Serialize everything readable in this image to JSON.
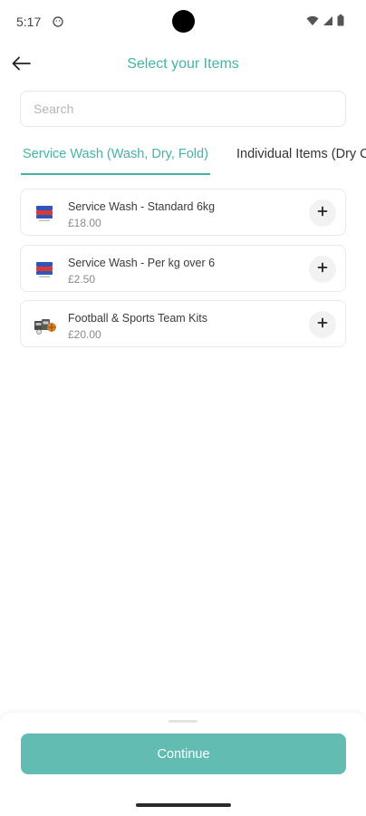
{
  "status_bar": {
    "time": "5:17",
    "notification_icon": "face-icon",
    "wifi_icon": "wifi-icon",
    "signal_icon": "signal-icon",
    "battery_icon": "battery-icon"
  },
  "header": {
    "title": "Select your Items",
    "back_icon": "arrow-left-icon"
  },
  "search": {
    "placeholder": "Search",
    "value": ""
  },
  "tabs": [
    {
      "label": "Service Wash (Wash, Dry, Fold)",
      "active": true
    },
    {
      "label": "Individual Items (Dry Cleaning)",
      "active": false
    }
  ],
  "items": [
    {
      "name": "Service Wash - Standard 6kg",
      "price": "£18.00",
      "icon": "folded-laundry-icon"
    },
    {
      "name": "Service Wash - Per kg over 6",
      "price": "£2.50",
      "icon": "folded-laundry-icon"
    },
    {
      "name": "Football & Sports Team Kits",
      "price": "£20.00",
      "icon": "sports-kit-icon"
    }
  ],
  "add_icon": "plus-icon",
  "bottom": {
    "continue_label": "Continue"
  },
  "colors": {
    "accent": "#45b3a6",
    "button": "#62bcb2"
  }
}
